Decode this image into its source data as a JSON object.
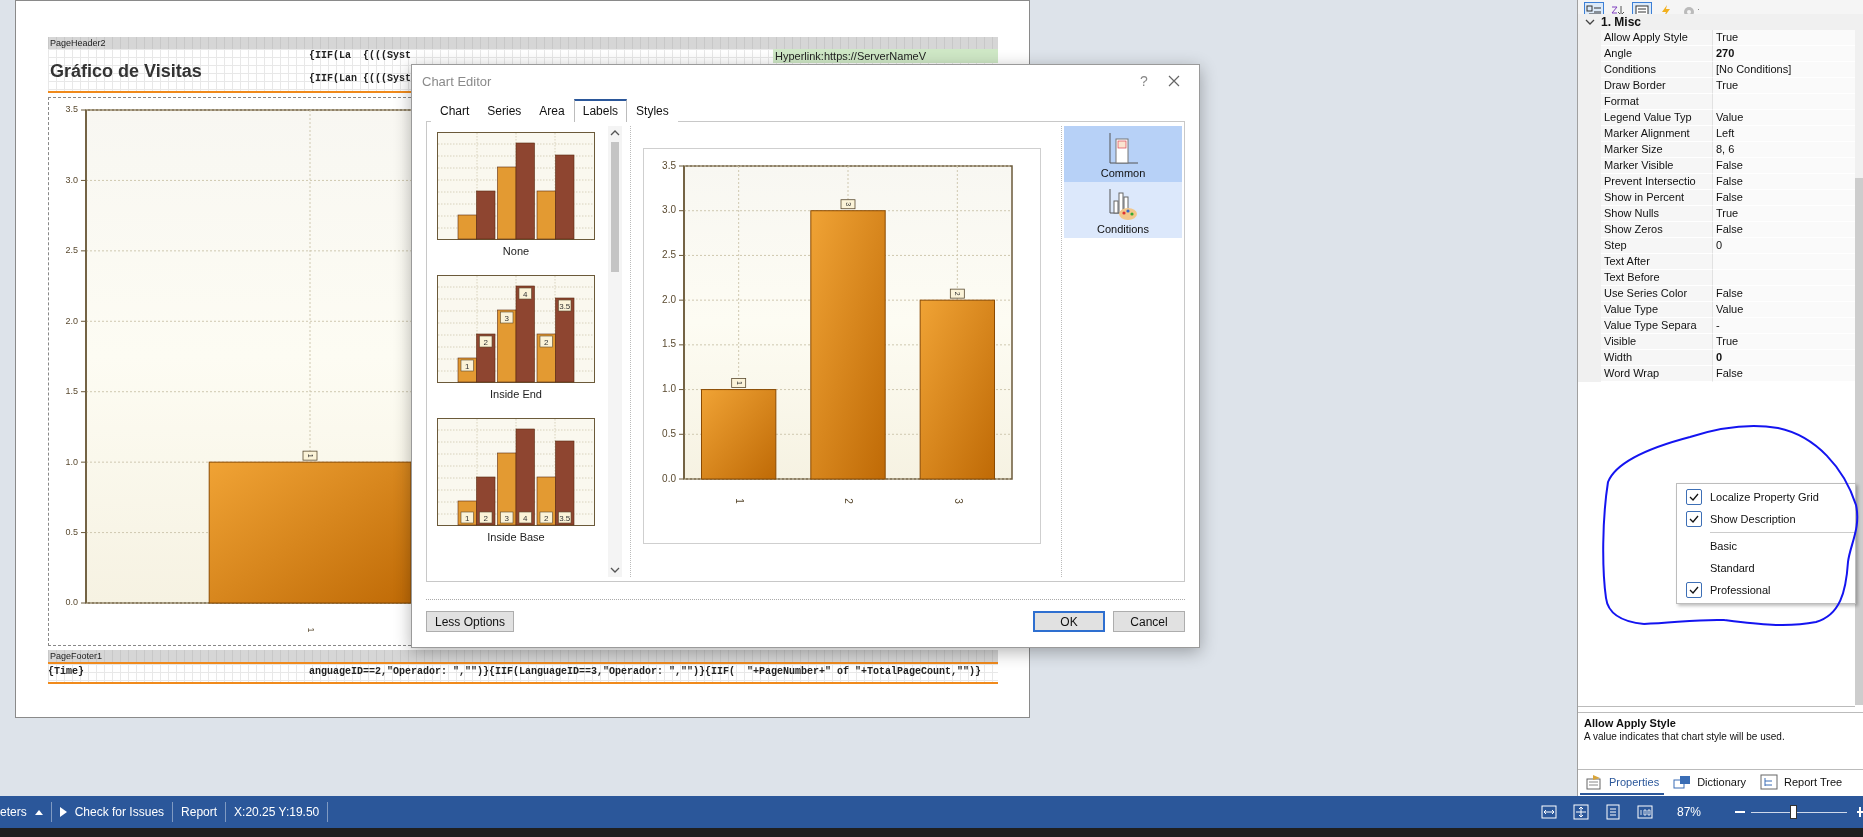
{
  "report": {
    "header_band": "PageHeader2",
    "title": "Gráfico de Visitas",
    "header_fields": [
      "{IIF(La",
      "{(((Syst",
      "{IIF(Lan",
      "{(((Syst"
    ],
    "hyperlink": "Hyperlink:https://ServerNameV",
    "chart": {
      "chart_data": {
        "type": "bar",
        "categories": [
          "1"
        ],
        "values": [
          1
        ],
        "ylim": [
          0,
          3.5
        ],
        "yticks": [
          {
            "value": 0,
            "label": "0.0"
          },
          {
            "value": 0.5,
            "label": "0.5"
          },
          {
            "value": 1,
            "label": "1.0"
          },
          {
            "value": 1.5,
            "label": "1.5"
          },
          {
            "value": 2,
            "label": "2.0"
          },
          {
            "value": 2.5,
            "label": "2.5"
          },
          {
            "value": 3,
            "label": "3.0"
          },
          {
            "value": 3.5,
            "label": "3.5"
          }
        ],
        "grid": true,
        "data_labels": true
      }
    },
    "footer_band": "PageFooter1",
    "footer_fields": [
      "{Time}",
      "anguageID==2,\"Operador: \",\"\")}{IIF(LanguageID==3,\"Operador: \",\"\")}{IIF(",
      "\"+PageNumber+\" of \"+TotalPageCount,\"\")}"
    ]
  },
  "dialog": {
    "title": "Chart Editor",
    "help": "?",
    "tabs": [
      {
        "label": "Chart",
        "selected": false
      },
      {
        "label": "Series",
        "selected": false
      },
      {
        "label": "Area",
        "selected": false
      },
      {
        "label": "Labels",
        "selected": true
      },
      {
        "label": "Styles",
        "selected": false
      }
    ],
    "gallery": [
      {
        "label": "None",
        "kind": "none"
      },
      {
        "label": "Inside End",
        "kind": "inside_end",
        "data_labels": [
          "1",
          "2",
          "3",
          "4",
          "2",
          "3.5"
        ]
      },
      {
        "label": "Inside Base",
        "kind": "inside_base",
        "data_labels": [
          "1",
          "2",
          "3",
          "4",
          "2",
          "3.5"
        ]
      }
    ],
    "preview": {
      "chart_data": {
        "type": "bar",
        "categories": [
          "1",
          "2",
          "3"
        ],
        "values": [
          1,
          3,
          2
        ],
        "ylim": [
          0,
          3.5
        ],
        "yticks": [
          {
            "value": 0,
            "label": "0.0"
          },
          {
            "value": 0.5,
            "label": "0.5"
          },
          {
            "value": 1,
            "label": "1.0"
          },
          {
            "value": 1.5,
            "label": "1.5"
          },
          {
            "value": 2,
            "label": "2.0"
          },
          {
            "value": 2.5,
            "label": "2.5"
          },
          {
            "value": 3,
            "label": "3.0"
          },
          {
            "value": 3.5,
            "label": "3.5"
          }
        ],
        "grid": true,
        "data_labels": true
      }
    },
    "sections": [
      {
        "label": "Common",
        "kind": "common",
        "selected": true
      },
      {
        "label": "Conditions",
        "kind": "conditions",
        "selected": false
      }
    ],
    "buttons": [
      {
        "label": "Less Options",
        "kind": "toggle"
      },
      {
        "label": "OK",
        "kind": "default"
      },
      {
        "label": "Cancel",
        "kind": "cancel"
      }
    ]
  },
  "properties_panel": {
    "toolbar": [
      {
        "kind": "categorized",
        "selected": true
      },
      {
        "kind": "alphabetical",
        "selected": false
      },
      {
        "kind": "properties",
        "selected": true
      },
      {
        "kind": "events",
        "selected": false
      },
      {
        "kind": "settings",
        "selected": false
      }
    ],
    "category": {
      "label": "1. Misc",
      "expanded": true
    },
    "rows": [
      {
        "name": "Allow Apply Style",
        "value": "True",
        "modified": false
      },
      {
        "name": "Angle",
        "value": "270",
        "modified": true
      },
      {
        "name": "Conditions",
        "value": "[No Conditions]",
        "modified": false
      },
      {
        "name": "Draw Border",
        "value": "True",
        "modified": false
      },
      {
        "name": "Format"
      },
      {
        "name": "Legend Value Typ",
        "value": "Value",
        "modified": false
      },
      {
        "name": "Marker Alignment",
        "value": "Left",
        "modified": false
      },
      {
        "name": "Marker Size",
        "value": "8, 6",
        "modified": false
      },
      {
        "name": "Marker Visible",
        "value": "False",
        "modified": false
      },
      {
        "name": "Prevent Intersectio",
        "value": "False",
        "modified": false
      },
      {
        "name": "Show in Percent",
        "value": "False",
        "modified": false
      },
      {
        "name": "Show Nulls",
        "value": "True",
        "modified": false
      },
      {
        "name": "Show Zeros",
        "value": "False",
        "modified": false
      },
      {
        "name": "Step",
        "value": "0",
        "modified": false
      },
      {
        "name": "Text After"
      },
      {
        "name": "Text Before"
      },
      {
        "name": "Use Series Color",
        "value": "False",
        "modified": false
      },
      {
        "name": "Value Type",
        "value": "Value",
        "modified": false
      },
      {
        "name": "Value Type Separa",
        "value": "-",
        "modified": false
      },
      {
        "name": "Visible",
        "value": "True",
        "modified": false
      },
      {
        "name": "Width",
        "value": "0",
        "modified": true
      },
      {
        "name": "Word Wrap",
        "value": "False",
        "modified": false
      }
    ],
    "menu": [
      {
        "kind": "item",
        "label": "Localize Property Grid",
        "checked": true
      },
      {
        "kind": "item",
        "label": "Show Description",
        "checked": true
      },
      {
        "kind": "separator"
      },
      {
        "kind": "item",
        "label": "Basic",
        "checked": false
      },
      {
        "kind": "item",
        "label": "Standard",
        "checked": false
      },
      {
        "kind": "item",
        "label": "Professional",
        "checked": true
      }
    ],
    "description": {
      "title": "Allow Apply Style",
      "text": "A value indicates that chart style will be used."
    },
    "tabs": [
      {
        "label": "Properties",
        "kind": "properties",
        "selected": true
      },
      {
        "label": "Dictionary",
        "kind": "dictionary",
        "selected": false
      },
      {
        "label": "Report Tree",
        "kind": "tree",
        "selected": false
      }
    ]
  },
  "status_bar": {
    "items": [
      {
        "text": "eters",
        "kind": "menu"
      },
      {
        "text": "Check for Issues",
        "kind": "action"
      },
      {
        "text": "Report",
        "kind": "plain"
      },
      {
        "text": "X:20.25 Y:19.50",
        "kind": "plain"
      }
    ],
    "zoom": "87%",
    "zoom_slider": {
      "level": 0.44
    }
  }
}
